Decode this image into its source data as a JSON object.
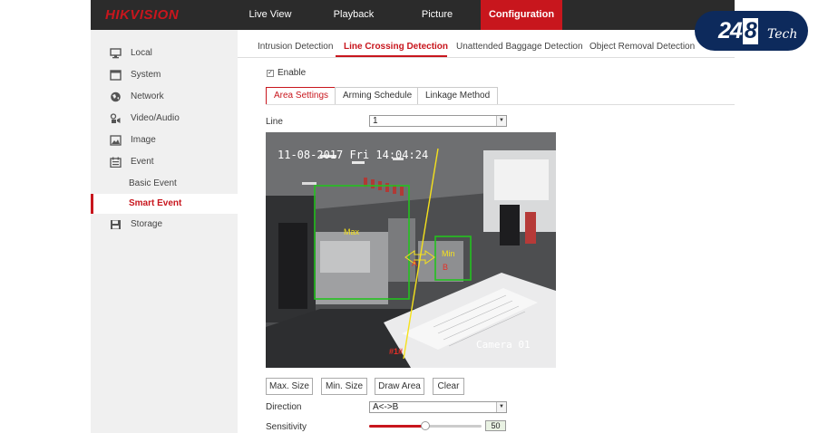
{
  "brand": {
    "logo": "HIKVISION"
  },
  "nav": {
    "items": [
      {
        "label": "Live View"
      },
      {
        "label": "Playback"
      },
      {
        "label": "Picture"
      },
      {
        "label": "Configuration",
        "active": true
      }
    ]
  },
  "sidebar": {
    "items": [
      {
        "label": "Local",
        "icon": "monitor-icon"
      },
      {
        "label": "System",
        "icon": "window-icon"
      },
      {
        "label": "Network",
        "icon": "globe-icon"
      },
      {
        "label": "Video/Audio",
        "icon": "video-audio-icon"
      },
      {
        "label": "Image",
        "icon": "image-icon"
      },
      {
        "label": "Event",
        "icon": "calendar-icon"
      }
    ],
    "event_sub": [
      {
        "label": "Basic Event"
      },
      {
        "label": "Smart Event",
        "active": true
      }
    ],
    "storage": {
      "label": "Storage",
      "icon": "floppy-icon"
    }
  },
  "tabs": [
    {
      "label": "Intrusion Detection"
    },
    {
      "label": "Line Crossing Detection",
      "active": true
    },
    {
      "label": "Unattended Baggage Detection"
    },
    {
      "label": "Object Removal Detection"
    }
  ],
  "enable": {
    "label": "Enable",
    "checked": true
  },
  "subtabs": [
    {
      "label": "Area Settings",
      "active": true
    },
    {
      "label": "Arming Schedule"
    },
    {
      "label": "Linkage Method"
    }
  ],
  "line": {
    "label": "Line",
    "value": "1"
  },
  "video": {
    "timestamp": "11-08-2017 Fri 14:04:24",
    "camera_name": "Camera 01",
    "max_label": "Max",
    "min_label": "Min",
    "side_a": "A",
    "side_b": "B",
    "line_id": "#1#"
  },
  "buttons": {
    "max_size": "Max. Size",
    "min_size": "Min. Size",
    "draw_area": "Draw Area",
    "clear": "Clear"
  },
  "direction": {
    "label": "Direction",
    "value": "A<->B"
  },
  "sensitivity": {
    "label": "Sensitivity",
    "value": 50,
    "value_text": "50"
  },
  "badge": {
    "number": "24",
    "eight": "8",
    "tech": "Tech"
  },
  "colors": {
    "accent": "#c8161d",
    "topbar": "#2b2b2b",
    "detect_box": "#23c21f",
    "rule_line": "#f5e11c",
    "badge_bg": "#0d2a5c"
  }
}
